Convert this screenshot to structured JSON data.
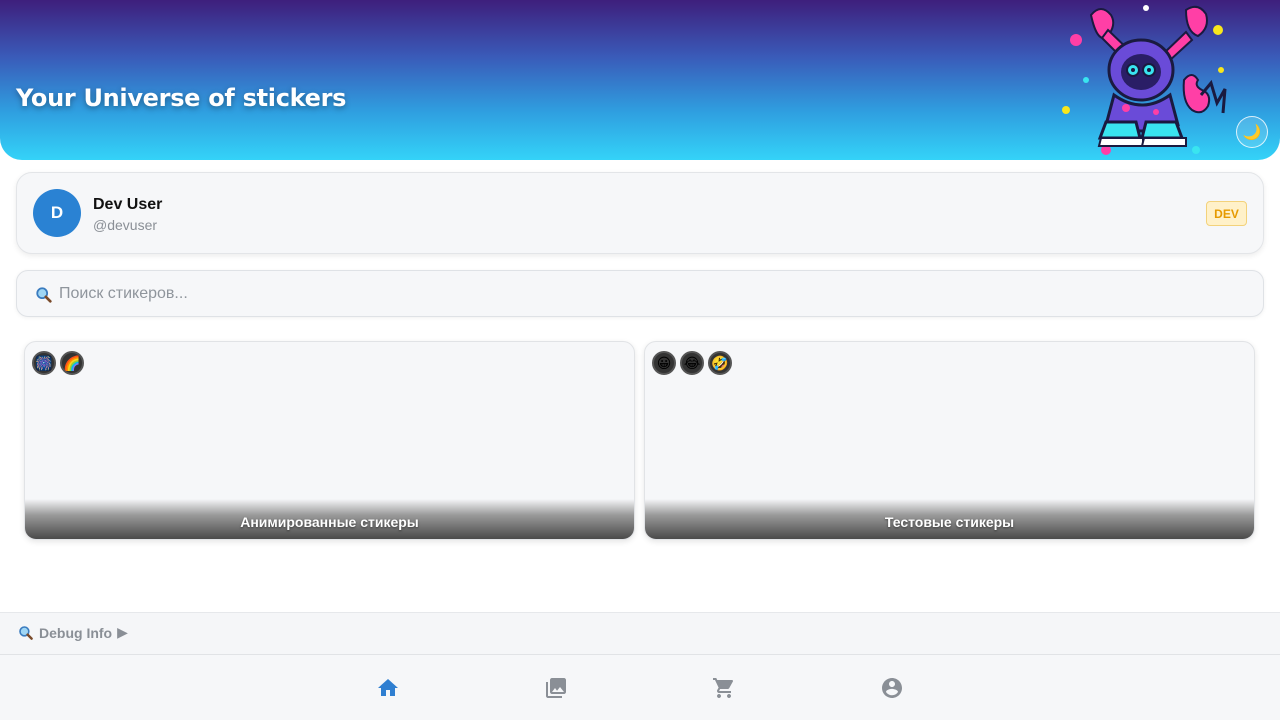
{
  "header": {
    "title": "Your Universe of stickers",
    "theme_toggle_icon": "moon-icon"
  },
  "profile": {
    "avatar_letter": "D",
    "name": "Dev User",
    "handle": "@devuser",
    "badge": "DEV"
  },
  "search": {
    "placeholder": "Поиск стикеров...",
    "value": "",
    "icon": "search-icon"
  },
  "packs": [
    {
      "title": "Анимированные стикеры",
      "previews": [
        "🎆",
        "🌈"
      ]
    },
    {
      "title": "Тестовые стикеры",
      "previews": [
        "😀",
        "😂",
        "🤣"
      ]
    }
  ],
  "debug": {
    "label": "Debug Info",
    "arrow": "▶"
  },
  "nav": {
    "items": [
      {
        "name": "home",
        "icon": "home-icon",
        "active": true
      },
      {
        "name": "gallery",
        "icon": "image-icon",
        "active": false
      },
      {
        "name": "cart",
        "icon": "cart-icon",
        "active": false
      },
      {
        "name": "profile",
        "icon": "account-icon",
        "active": false
      }
    ],
    "active_color": "#2f7fd1",
    "inactive_color": "#8a8f96"
  },
  "colors": {
    "accent": "#2a82d3",
    "badge_bg": "#fff1c9",
    "badge_text": "#e69a00"
  }
}
